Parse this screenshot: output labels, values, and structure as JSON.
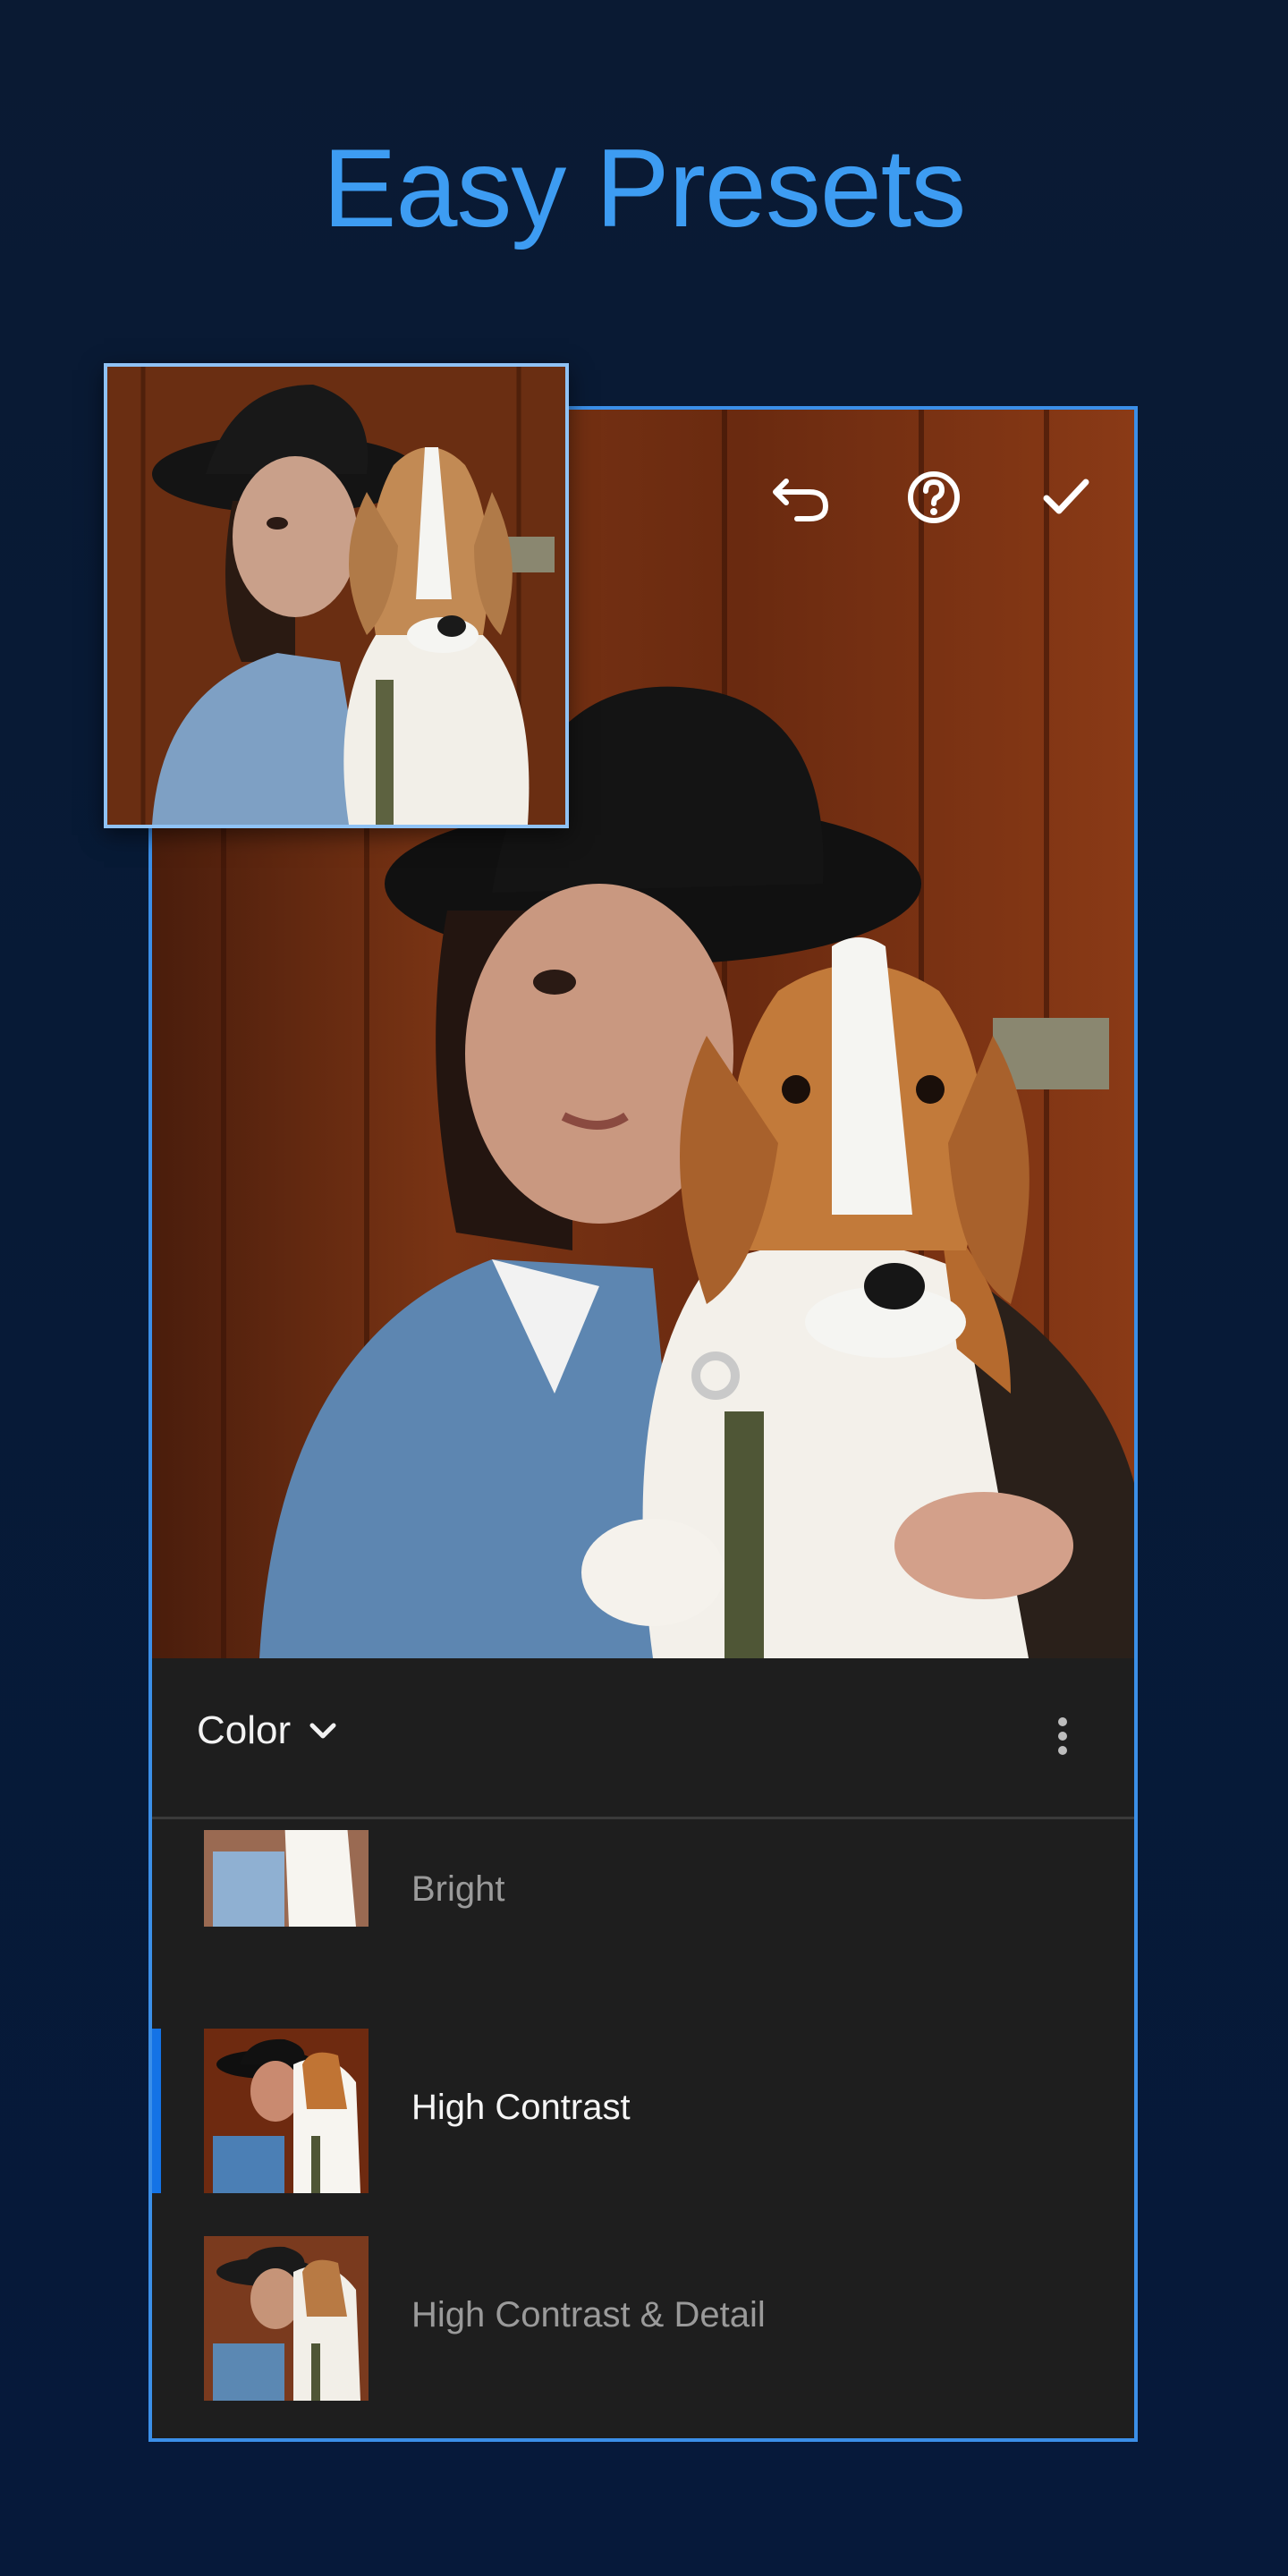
{
  "headline": "Easy Presets",
  "toolbar": {
    "undo_icon": "undo-icon",
    "help_icon": "help-icon",
    "confirm_icon": "checkmark-icon"
  },
  "panel": {
    "group_label": "Color",
    "group_icon": "chevron-down-icon",
    "more_icon": "more-vertical-icon"
  },
  "presets": [
    {
      "label": "Bright",
      "selected": false
    },
    {
      "label": "High Contrast",
      "selected": true
    },
    {
      "label": "High Contrast & Detail",
      "selected": false
    },
    {
      "label": "",
      "selected": false
    }
  ],
  "colors": {
    "accent": "#3d9cf2",
    "selection": "#1473e6",
    "panel_bg": "#1e1e1e"
  }
}
